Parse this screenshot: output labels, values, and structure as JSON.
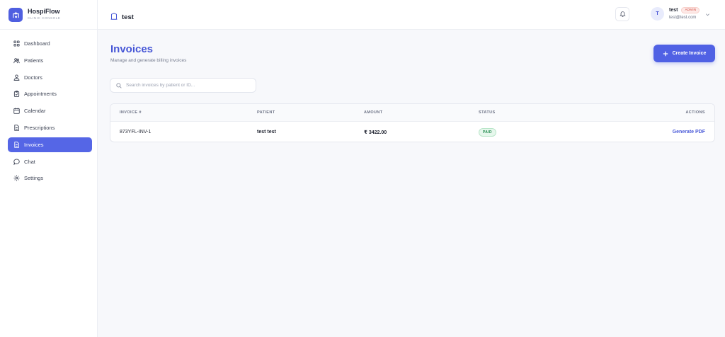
{
  "brand": {
    "name": "HospiFlow",
    "subtitle": "CLINIC CONSOLE"
  },
  "sidebar": {
    "items": [
      {
        "label": "Dashboard",
        "icon": "grid-icon",
        "active": false
      },
      {
        "label": "Patients",
        "icon": "users-icon",
        "active": false
      },
      {
        "label": "Doctors",
        "icon": "stethoscope-icon",
        "active": false
      },
      {
        "label": "Appointments",
        "icon": "clipboard-icon",
        "active": false
      },
      {
        "label": "Calendar",
        "icon": "calendar-icon",
        "active": false
      },
      {
        "label": "Prescriptions",
        "icon": "document-icon",
        "active": false
      },
      {
        "label": "Invoices",
        "icon": "invoice-icon",
        "active": true
      },
      {
        "label": "Chat",
        "icon": "chat-icon",
        "active": false
      },
      {
        "label": "Settings",
        "icon": "gear-icon",
        "active": false
      }
    ]
  },
  "header": {
    "clinic_name": "test",
    "user": {
      "initial": "T",
      "name": "test",
      "role": "ADMIN",
      "email": "test@test.com"
    }
  },
  "main": {
    "title": "Invoices",
    "subtitle": "Manage and generate billing invoices",
    "create_label": "Create Invoice",
    "search_placeholder": "Search invoices by patient or ID...",
    "table": {
      "headers": [
        "INVOICE #",
        "PATIENT",
        "AMOUNT",
        "STATUS",
        "ACTIONS"
      ],
      "rows": [
        {
          "invoice": "873YFL-INV-1",
          "patient": "test test",
          "amount": "₹ 3422.00",
          "status": "PAID",
          "action": "Generate PDF"
        }
      ]
    }
  },
  "colors": {
    "accent": "#5566e6",
    "title": "#4656d6",
    "paid": "#1f8a4c",
    "admin": "#d0473b"
  }
}
